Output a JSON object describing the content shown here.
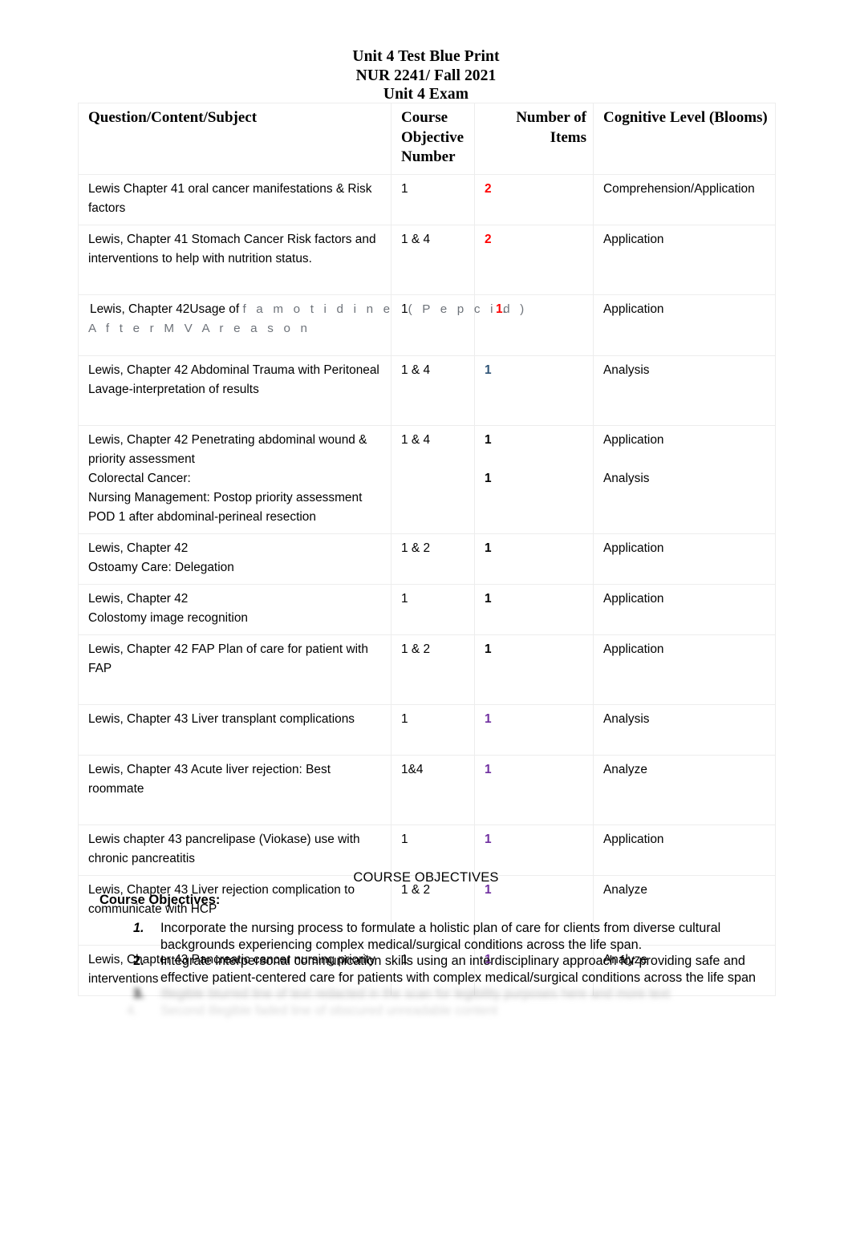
{
  "document": {
    "title_lines": [
      "Unit 4 Test Blue Print",
      "NUR 2241/ Fall 2021",
      "Unit 4 Exam"
    ]
  },
  "colors": {
    "red_count": "#FF0000",
    "blue_count": "#2F5477",
    "purple_count": "#7030A0",
    "faint_text": "#6E737A",
    "table_border": "#EDEDED"
  },
  "table": {
    "headers": {
      "subject": "Question/Content/Subject",
      "objective": "Course Objective Number",
      "items": "Number of Items",
      "blooms": "Cognitive Level (Blooms)"
    },
    "rows": [
      {
        "subject": "Lewis Chapter 41 oral cancer manifestations    & Risk factors",
        "objective": "1",
        "items": "2",
        "items_color": "red",
        "blooms": "Comprehension/Application"
      },
      {
        "subject": "Lewis, Chapter 41 Stomach Cancer Risk factors and interventions to help with nutrition status.",
        "objective": "1 & 4",
        "items": "2",
        "items_color": "red",
        "blooms": "Application"
      },
      {
        "subject": "Lewis, Chapter 42Usage of",
        "subject_faint": "f a m o t i d i n e",
        "subject_faint_2": "( P e p c i d )",
        "subject_faint_3": "A f t e r   M V A   r e a s o n",
        "objective": "1",
        "items": "1",
        "items_color": "red",
        "items_trailing": ".",
        "blooms": "Application"
      },
      {
        "subject": "Lewis, Chapter 42 Abdominal Trauma with Peritoneal Lavage-interpretation of results",
        "objective": "1 & 4",
        "items": "1",
        "items_color": "blue",
        "blooms": " Analysis"
      },
      {
        "subject": "Lewis, Chapter 42 Penetrating abdominal wound & priority assessment",
        "subject_extra": [
          "Colorectal Cancer:",
          "Nursing Management: Postop priority assessment POD 1 after abdominal-perineal resection"
        ],
        "objective": "1 & 4",
        "items": "1",
        "items_color": "black",
        "items_extra": "1",
        "blooms": "Application",
        "blooms_extra": "Analysis"
      },
      {
        "subject": "Lewis, Chapter 42",
        "subject_extra": [
          "Ostoamy Care: Delegation"
        ],
        "objective": "1 & 2",
        "items": "1",
        "items_color": "black",
        "blooms": "Application"
      },
      {
        "subject": "Lewis, Chapter 42",
        "subject_extra": [
          "Colostomy image recognition"
        ],
        "objective": "1",
        "items": "1",
        "items_color": "black",
        "blooms": "Application"
      },
      {
        "subject": "Lewis, Chapter 42 FAP Plan of care for patient with FAP",
        "objective": "1 & 2",
        "items": "1",
        "items_color": "black",
        "blooms": "Application"
      },
      {
        "subject": "Lewis, Chapter 43 Liver transplant complications",
        "objective": "1",
        "items": "1",
        "items_color": "purple",
        "blooms": "Analysis"
      },
      {
        "subject": "Lewis, Chapter 43 Acute liver rejection: Best roommate",
        "objective": "1&4",
        "items": "1",
        "items_color": "purple",
        "blooms": "Analyze"
      },
      {
        "subject": "Lewis chapter 43 pancrelipase (Viokase) use with chronic pancreatitis",
        "objective": "1",
        "items": "1",
        "items_color": "purple",
        "blooms": "Application"
      },
      {
        "subject": "Lewis, Chapter 43   Liver rejection complication to communicate with HCP",
        "objective": "1 & 2",
        "items": "1",
        "items_color": "purple",
        "blooms": "Analyze"
      },
      {
        "subject": "Lewis, Chapter 43 Pancreatic cancer nursing priority interventions",
        "objective": "1",
        "items": "1",
        "items_color": "purple",
        "blooms": "Analyze"
      }
    ]
  },
  "course_objectives": {
    "section_heading": "COURSE OBJECTIVES",
    "label": "Course Objectives:",
    "items": [
      {
        "number": "1.",
        "text": "Incorporate the nursing process to formulate a holistic plan of care for clients from diverse cultural backgrounds experiencing complex medical/surgical conditions across the life span.",
        "state": "visible"
      },
      {
        "number": "2.",
        "text": "Integrate interpersonal communication skills using an interdisciplinary approach for providing safe and effective patient-centered care for patients with complex medical/surgical conditions across the life span",
        "state": "visible"
      },
      {
        "number": "3.",
        "text": "Illegible blurred line of text redacted in the scan for legibility purposes here and more text",
        "state": "blurred"
      },
      {
        "number": "4.",
        "text": "Second illegible faded line of obscured unreadable content",
        "state": "faded"
      }
    ]
  }
}
